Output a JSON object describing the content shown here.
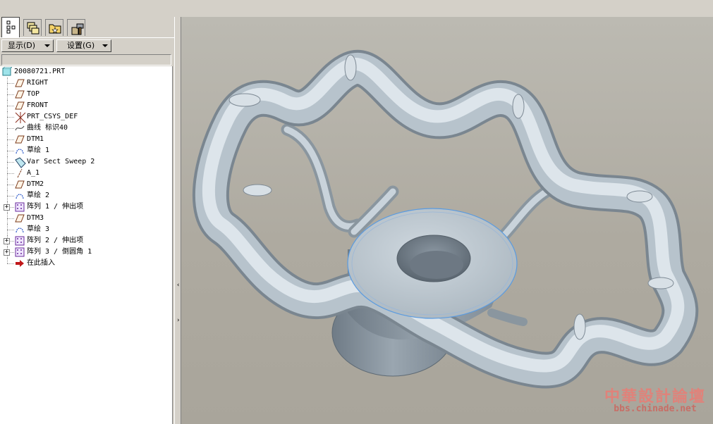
{
  "panel": {
    "tabs": [
      {
        "name": "model-tree-tab",
        "icon": "model-tree-icon"
      },
      {
        "name": "layers-tab",
        "icon": "layers-icon"
      },
      {
        "name": "folder-tab",
        "icon": "folder-browser-icon"
      },
      {
        "name": "favorites-tab",
        "icon": "tools-icon"
      }
    ],
    "show_label": "显示(D)",
    "settings_label": "设置(G)"
  },
  "tree": {
    "items": [
      {
        "label": "20080721.PRT",
        "icon": "part-icon",
        "expandable": false
      },
      {
        "label": "RIGHT",
        "icon": "datum-plane-icon",
        "expandable": false
      },
      {
        "label": "TOP",
        "icon": "datum-plane-icon",
        "expandable": false
      },
      {
        "label": "FRONT",
        "icon": "datum-plane-icon",
        "expandable": false
      },
      {
        "label": "PRT_CSYS_DEF",
        "icon": "csys-icon",
        "expandable": false
      },
      {
        "label": "曲线 标识40",
        "icon": "curve-icon",
        "expandable": false
      },
      {
        "label": "DTM1",
        "icon": "datum-plane-icon",
        "expandable": false
      },
      {
        "label": "草绘 1",
        "icon": "sketch-icon",
        "expandable": false
      },
      {
        "label": "Var Sect Sweep 2",
        "icon": "sweep-icon",
        "expandable": false
      },
      {
        "label": "A_1",
        "icon": "axis-icon",
        "expandable": false
      },
      {
        "label": "DTM2",
        "icon": "datum-plane-icon",
        "expandable": false
      },
      {
        "label": "草绘 2",
        "icon": "sketch-icon",
        "expandable": false
      },
      {
        "label": "阵列 1 / 伸出项",
        "icon": "pattern-icon",
        "expandable": true
      },
      {
        "label": "DTM3",
        "icon": "datum-plane-icon",
        "expandable": false
      },
      {
        "label": "草绘 3",
        "icon": "sketch-icon",
        "expandable": false
      },
      {
        "label": "阵列 2 / 伸出项",
        "icon": "pattern-icon",
        "expandable": true
      },
      {
        "label": "阵列 3 / 倒圆角 1",
        "icon": "pattern-icon",
        "expandable": true
      },
      {
        "label": "在此插入",
        "icon": "insert-here-arrow-icon",
        "expandable": false
      }
    ]
  },
  "watermark": {
    "line1": "中華設計論壇",
    "line2": "bbs.chinade.net"
  },
  "colors": {
    "model_surface": "#c5d0d8",
    "model_shadow": "#7d8a94",
    "viewport_bg": "#b3b0a7",
    "selection_edge": "#5a9be0",
    "watermark": "#e0827a"
  }
}
